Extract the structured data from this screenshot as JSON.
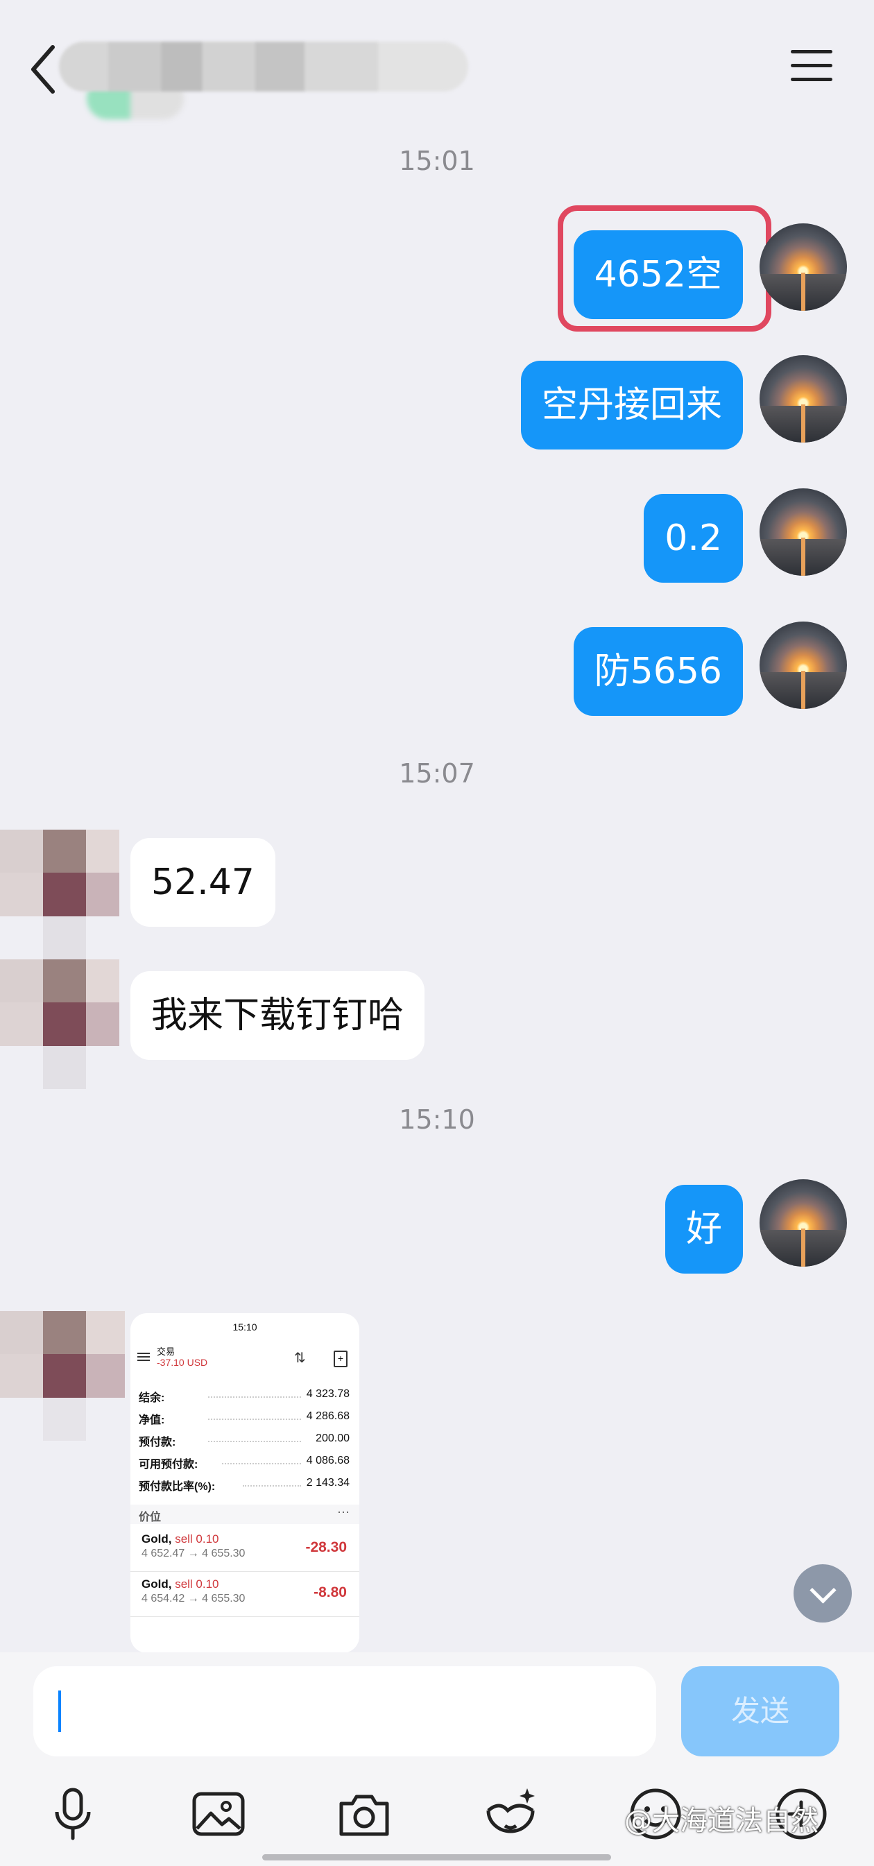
{
  "header": {
    "back_icon": "chevron-left-icon",
    "menu_icon": "hamburger-menu-icon"
  },
  "messages": {
    "ts1": "15:01",
    "out1": "4652空",
    "out2": "空丹接回来",
    "out3": "0.2",
    "out4": "防5656",
    "ts2": "15:07",
    "in1": "52.47",
    "in2": "我来下载钉钉哈",
    "ts3": "15:10",
    "out5": "好"
  },
  "screenshot": {
    "status_time": "15:10",
    "title": "交易",
    "profit": "-37.10 USD",
    "rows": [
      {
        "label": "结余:",
        "value": "4 323.78"
      },
      {
        "label": "净值:",
        "value": "4 286.68"
      },
      {
        "label": "预付款:",
        "value": "200.00"
      },
      {
        "label": "可用预付款:",
        "value": "4 086.68"
      },
      {
        "label": "预付款比率(%):",
        "value": "2 143.34"
      }
    ],
    "section_label": "价位",
    "section_more": "···",
    "positions": [
      {
        "symbol": "Gold,",
        "side": "sell 0.10",
        "prices": "4 652.47 → 4 655.30",
        "pl": "-28.30"
      },
      {
        "symbol": "Gold,",
        "side": "sell 0.10",
        "prices": "4 654.42 → 4 655.30",
        "pl": "-8.80"
      }
    ]
  },
  "input": {
    "placeholder": "",
    "send_label": "发送"
  },
  "toolbar": {
    "icons": [
      "microphone-icon",
      "image-icon",
      "camera-icon",
      "sticker-icon",
      "emoji-icon",
      "add-icon"
    ]
  },
  "watermark": "@大海道法自然",
  "colors": {
    "bubble_out": "#1596f9",
    "bubble_in": "#ffffff",
    "background": "#efeff4",
    "highlight": "#e0475f",
    "send_disabled": "#86c6fb"
  }
}
